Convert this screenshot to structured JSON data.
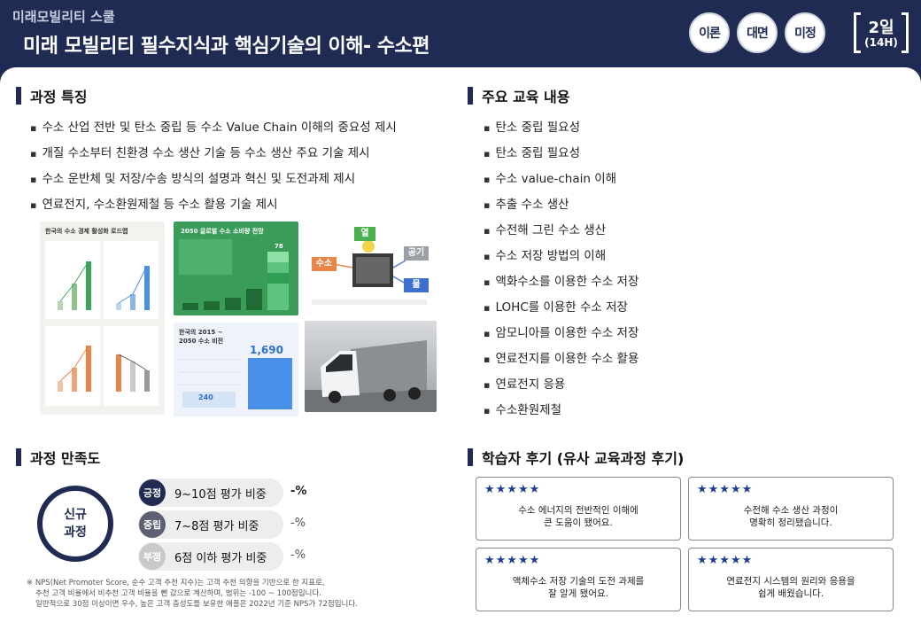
{
  "header": {
    "school": "미래모빌리티 스쿨",
    "title": "미래 모빌리티 필수지식과 핵심기술의 이해- 수소편",
    "badges": [
      "이론",
      "대면",
      "미정"
    ],
    "duration_days": "2일",
    "duration_hours": "(14H)"
  },
  "features": {
    "title": "과정 특징",
    "items": [
      "수소 산업 전반 및 탄소 중립 등 수소 Value Chain 이해의 중요성 제시",
      "개질 수소부터 친환경 수소 생산 기술 등 수소 생산 주요 기술 제시",
      "수소 운반체 및 저장/수송 방식의 설명과 혁신 및 도전과제 제시",
      "연료전지, 수소환원제철 등 수소 활용 기술 제시"
    ],
    "images": {
      "img1_title": "한국의 수소 경제 활성화 로드맵",
      "img2_title": "2050 글로벌 수소 소비량 전망",
      "img2_top_value": "78",
      "img3_labels": [
        "열",
        "수소",
        "공기",
        "물"
      ],
      "img4_title": "한국의 2015 ~ 2050 수소 비전",
      "img4_big": "1,690",
      "img4_small": "240"
    }
  },
  "edu": {
    "title": "주요 교육 내용",
    "items": [
      "탄소 중립 필요성",
      "탄소 중립 필요성",
      "수소 value-chain 이해",
      "추출 수소 생산",
      "수전해 그린 수소 생산",
      "수소 저장 방법의 이해",
      "액화수소를 이용한 수소 저장",
      "LOHC를 이용한 수소 저장",
      "암모니아를 이용한 수소 저장",
      "연료전지를 이용한 수소 활용",
      "연료전지 응용",
      "수소환원제철"
    ]
  },
  "satisfaction": {
    "title": "과정 만족도",
    "circle_line1": "신규",
    "circle_line2": "과정",
    "rows": [
      {
        "tag": "긍정",
        "label": "9~10점 평가 비중",
        "value": "-%",
        "color": "#1f2b52"
      },
      {
        "tag": "중립",
        "label": "7~8점 평가 비중",
        "value": "-%",
        "color": "#5b6173"
      },
      {
        "tag": "부정",
        "label": "6점 이하 평가 비중",
        "value": "-%",
        "color": "#c9c9c9"
      }
    ],
    "note_line1": "※ NPS(Net Promoter Score, 순수 고객 추천 지수)는 고객 추천 의향을 기반으로 한 지표로,",
    "note_line2": "추천 고객 비율에서 비추천 고객 비율을 뺀 값으로 계산하며, 범위는 -100 ~ 100점입니다.",
    "note_line3": "일반적으로 30점 이상이면 우수, 높은 고객 충성도를 보유한 애플은 2022년 기준 NPS가 72점입니다."
  },
  "reviews": {
    "title": "학습자 후기 (유사 교육과정 후기)",
    "stars": "★★★★★",
    "items": [
      "수소 에너지의 전반적인 이해에\n큰 도움이 됐어요.",
      "수전해 수소 생산 과정이\n명확히 정리됐습니다.",
      "액체수소 저장 기술의 도전 과제를\n잘 알게 됐어요.",
      "연료전지 시스템의 원리와 응용을\n쉽게 배웠습니다."
    ]
  },
  "colors": {
    "navy": "#1f2b52",
    "green": "#3aa45a",
    "orange": "#e8864a",
    "blue": "#4a90e2"
  }
}
